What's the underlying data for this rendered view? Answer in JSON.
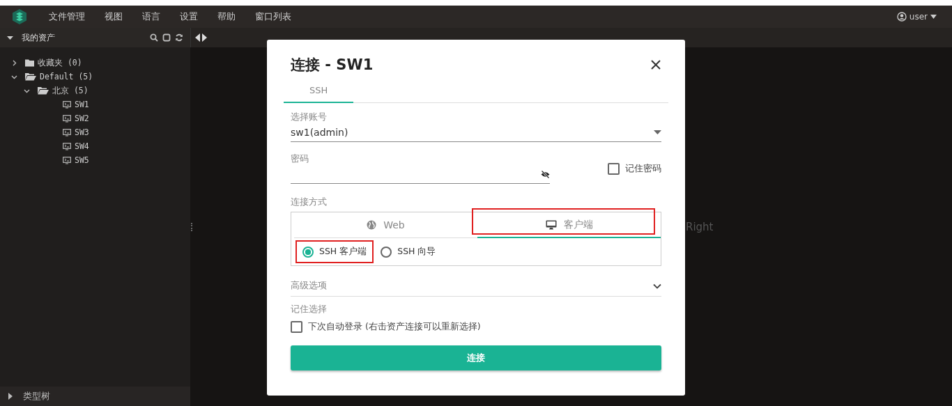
{
  "menubar": {
    "items": [
      "文件管理",
      "视图",
      "语言",
      "设置",
      "帮助",
      "窗口列表"
    ],
    "user": "user"
  },
  "sidebar": {
    "title": "我的资产",
    "expanded": true,
    "tree": [
      {
        "label": "收藏夹 (0)",
        "kind": "folder",
        "expanded": false
      },
      {
        "label": "Default (5)",
        "kind": "folder",
        "expanded": true,
        "children": [
          {
            "label": "北京 (5)",
            "kind": "folder",
            "expanded": true,
            "children": [
              {
                "label": "SW1",
                "kind": "device"
              },
              {
                "label": "SW2",
                "kind": "device"
              },
              {
                "label": "SW3",
                "kind": "device"
              },
              {
                "label": "SW4",
                "kind": "device"
              },
              {
                "label": "SW5",
                "kind": "device"
              }
            ]
          }
        ]
      }
    ],
    "footer": {
      "label": "类型树",
      "expanded": false
    }
  },
  "main": {
    "hint": "Right"
  },
  "dialog": {
    "title": "连接 - SW1",
    "tabs": [
      {
        "label": "SSH",
        "selected": true
      }
    ],
    "account": {
      "label": "选择账号",
      "value": "sw1(admin)"
    },
    "password": {
      "label": "密码",
      "remember": {
        "label": "记住密码",
        "checked": false
      }
    },
    "method": {
      "label": "连接方式",
      "tabs": [
        {
          "label": "Web",
          "kind": "globe",
          "selected": false,
          "highlighted": false
        },
        {
          "label": "客户端",
          "kind": "monitor",
          "selected": true,
          "highlighted": true
        }
      ],
      "options": [
        {
          "label": "SSH 客户端",
          "selected": true,
          "highlighted": true
        },
        {
          "label": "SSH 向导",
          "selected": false,
          "highlighted": false
        }
      ]
    },
    "advanced": {
      "label": "高级选项",
      "expanded": false
    },
    "remember": {
      "label": "记住选择",
      "option": {
        "label": "下次自动登录 (右击资产连接可以重新选择)",
        "checked": false
      }
    },
    "submit": "连接"
  }
}
